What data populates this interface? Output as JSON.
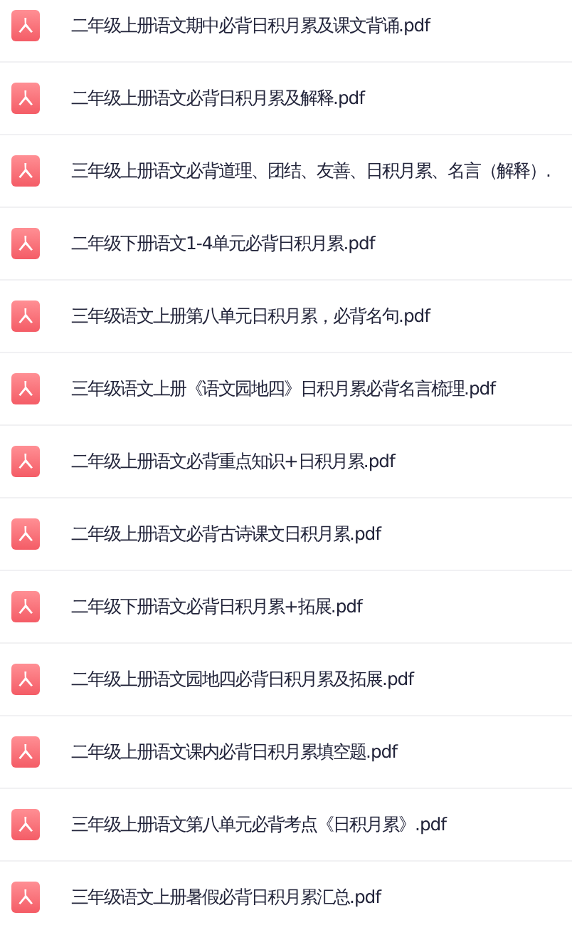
{
  "files": [
    {
      "name": "二年级上册语文期中必背日积月累及课文背诵.pdf"
    },
    {
      "name": "二年级上册语文必背日积月累及解释.pdf"
    },
    {
      "name": "三年级上册语文必背道理、团结、友善、日积月累、名言（解释）."
    },
    {
      "name": "二年级下册语文1-4单元必背日积月累.pdf"
    },
    {
      "name": "三年级语文上册第八单元日积月累，必背名句.pdf"
    },
    {
      "name": "三年级语文上册《语文园地四》日积月累必背名言梳理.pdf"
    },
    {
      "name": "二年级上册语文必背重点知识+日积月累.pdf"
    },
    {
      "name": "二年级上册语文必背古诗课文日积月累.pdf"
    },
    {
      "name": "二年级下册语文必背日积月累+拓展.pdf"
    },
    {
      "name": "二年级上册语文园地四必背日积月累及拓展.pdf"
    },
    {
      "name": "二年级上册语文课内必背日积月累填空题.pdf"
    },
    {
      "name": "三年级上册语文第八单元必背考点《日积月累》.pdf"
    },
    {
      "name": "三年级语文上册暑假必背日积月累汇总.pdf"
    }
  ]
}
